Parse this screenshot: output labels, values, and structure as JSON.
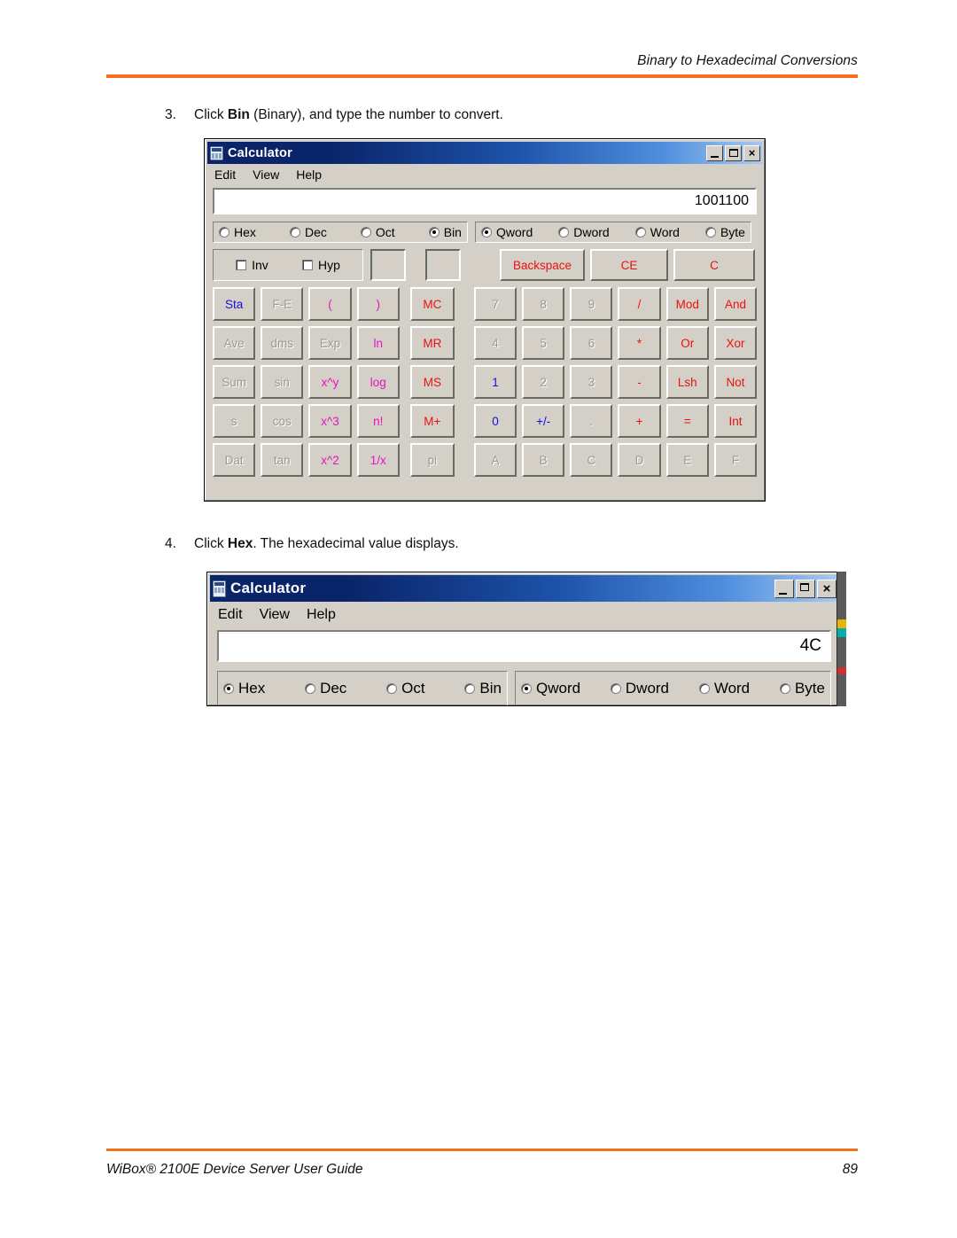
{
  "header": {
    "title": "Binary to Hexadecimal Conversions",
    "rule_color": "#f4701b"
  },
  "footer": {
    "guide": "WiBox® 2100E Device Server User Guide",
    "page": "89",
    "rule_color": "#f4701b"
  },
  "steps": [
    {
      "num": "3.",
      "prefix": "Click ",
      "bold": "Bin",
      "suffix": " (Binary), and type the number to convert."
    },
    {
      "num": "4.",
      "prefix": "Click ",
      "bold": "Hex",
      "suffix": ". The hexadecimal value displays."
    }
  ],
  "calculator_full": {
    "title": "Calculator",
    "titlebar_buttons": [
      {
        "name": "minimize",
        "label": ""
      },
      {
        "name": "maximize",
        "label": ""
      },
      {
        "name": "close",
        "label": "×"
      }
    ],
    "menu": [
      "Edit",
      "View",
      "Help"
    ],
    "display_value": "1001100",
    "base_radios": [
      {
        "label": "Hex",
        "selected": false
      },
      {
        "label": "Dec",
        "selected": false
      },
      {
        "label": "Oct",
        "selected": false
      },
      {
        "label": "Bin",
        "selected": true
      }
    ],
    "word_radios": [
      {
        "label": "Qword",
        "selected": true
      },
      {
        "label": "Dword",
        "selected": false
      },
      {
        "label": "Word",
        "selected": false
      },
      {
        "label": "Byte",
        "selected": false
      }
    ],
    "checkboxes": [
      {
        "label": "Inv",
        "checked": false
      },
      {
        "label": "Hyp",
        "checked": false
      }
    ],
    "edit_buttons": [
      {
        "label": "Backspace",
        "color": "red",
        "enabled": true
      },
      {
        "label": "CE",
        "color": "red",
        "enabled": true
      },
      {
        "label": "C",
        "color": "red",
        "enabled": true
      }
    ],
    "keypad_rows": [
      {
        "left": [
          {
            "label": "Sta",
            "color": "blue",
            "enabled": true
          },
          {
            "label": "F-E",
            "color": "dis",
            "enabled": false
          },
          {
            "label": "(",
            "color": "magenta",
            "enabled": true
          },
          {
            "label": ")",
            "color": "magenta",
            "enabled": true
          }
        ],
        "mem": {
          "label": "MC",
          "color": "red",
          "enabled": true
        },
        "right": [
          {
            "label": "7",
            "color": "dis",
            "enabled": false
          },
          {
            "label": "8",
            "color": "dis",
            "enabled": false
          },
          {
            "label": "9",
            "color": "dis",
            "enabled": false
          },
          {
            "label": "/",
            "color": "red",
            "enabled": true
          },
          {
            "label": "Mod",
            "color": "red",
            "enabled": true
          },
          {
            "label": "And",
            "color": "red",
            "enabled": true
          }
        ]
      },
      {
        "left": [
          {
            "label": "Ave",
            "color": "dis",
            "enabled": false
          },
          {
            "label": "dms",
            "color": "dis",
            "enabled": false
          },
          {
            "label": "Exp",
            "color": "dis",
            "enabled": false
          },
          {
            "label": "ln",
            "color": "magenta",
            "enabled": true
          }
        ],
        "mem": {
          "label": "MR",
          "color": "red",
          "enabled": true
        },
        "right": [
          {
            "label": "4",
            "color": "dis",
            "enabled": false
          },
          {
            "label": "5",
            "color": "dis",
            "enabled": false
          },
          {
            "label": "6",
            "color": "dis",
            "enabled": false
          },
          {
            "label": "*",
            "color": "red",
            "enabled": true
          },
          {
            "label": "Or",
            "color": "red",
            "enabled": true
          },
          {
            "label": "Xor",
            "color": "red",
            "enabled": true
          }
        ]
      },
      {
        "left": [
          {
            "label": "Sum",
            "color": "dis",
            "enabled": false
          },
          {
            "label": "sin",
            "color": "dis",
            "enabled": false
          },
          {
            "label": "x^y",
            "color": "magenta",
            "enabled": true
          },
          {
            "label": "log",
            "color": "magenta",
            "enabled": true
          }
        ],
        "mem": {
          "label": "MS",
          "color": "red",
          "enabled": true
        },
        "right": [
          {
            "label": "1",
            "color": "blue",
            "enabled": true
          },
          {
            "label": "2",
            "color": "dis",
            "enabled": false
          },
          {
            "label": "3",
            "color": "dis",
            "enabled": false
          },
          {
            "label": "-",
            "color": "red",
            "enabled": true
          },
          {
            "label": "Lsh",
            "color": "red",
            "enabled": true
          },
          {
            "label": "Not",
            "color": "red",
            "enabled": true
          }
        ]
      },
      {
        "left": [
          {
            "label": "s",
            "color": "dis",
            "enabled": false
          },
          {
            "label": "cos",
            "color": "dis",
            "enabled": false
          },
          {
            "label": "x^3",
            "color": "magenta",
            "enabled": true
          },
          {
            "label": "n!",
            "color": "magenta",
            "enabled": true
          }
        ],
        "mem": {
          "label": "M+",
          "color": "red",
          "enabled": true
        },
        "right": [
          {
            "label": "0",
            "color": "blue",
            "enabled": true
          },
          {
            "label": "+/-",
            "color": "blue",
            "enabled": true
          },
          {
            "label": ".",
            "color": "dis",
            "enabled": false
          },
          {
            "label": "+",
            "color": "red",
            "enabled": true
          },
          {
            "label": "=",
            "color": "red",
            "enabled": true
          },
          {
            "label": "Int",
            "color": "red",
            "enabled": true
          }
        ]
      },
      {
        "left": [
          {
            "label": "Dat",
            "color": "dis",
            "enabled": false
          },
          {
            "label": "tan",
            "color": "dis",
            "enabled": false
          },
          {
            "label": "x^2",
            "color": "magenta",
            "enabled": true
          },
          {
            "label": "1/x",
            "color": "magenta",
            "enabled": true
          }
        ],
        "mem": {
          "label": "pi",
          "color": "dis",
          "enabled": false
        },
        "right": [
          {
            "label": "A",
            "color": "dis",
            "enabled": false
          },
          {
            "label": "B",
            "color": "dis",
            "enabled": false
          },
          {
            "label": "C",
            "color": "dis",
            "enabled": false
          },
          {
            "label": "D",
            "color": "dis",
            "enabled": false
          },
          {
            "label": "E",
            "color": "dis",
            "enabled": false
          },
          {
            "label": "F",
            "color": "dis",
            "enabled": false
          }
        ]
      }
    ]
  },
  "calculator_hex": {
    "title": "Calculator",
    "menu": [
      "Edit",
      "View",
      "Help"
    ],
    "display_value": "4C",
    "base_radios": [
      {
        "label": "Hex",
        "selected": true
      },
      {
        "label": "Dec",
        "selected": false
      },
      {
        "label": "Oct",
        "selected": false
      },
      {
        "label": "Bin",
        "selected": false
      }
    ],
    "word_radios": [
      {
        "label": "Qword",
        "selected": true
      },
      {
        "label": "Dword",
        "selected": false
      },
      {
        "label": "Word",
        "selected": false
      },
      {
        "label": "Byte",
        "selected": false
      }
    ]
  },
  "colors": {
    "accent_orange": "#f4701b",
    "win_face": "#d4d0c8",
    "title_dark_blue": "#0a246a",
    "button_red": "#e8130f",
    "button_blue": "#1111dd",
    "button_magenta": "#e215c0",
    "button_disabled": "#9a9a94"
  }
}
